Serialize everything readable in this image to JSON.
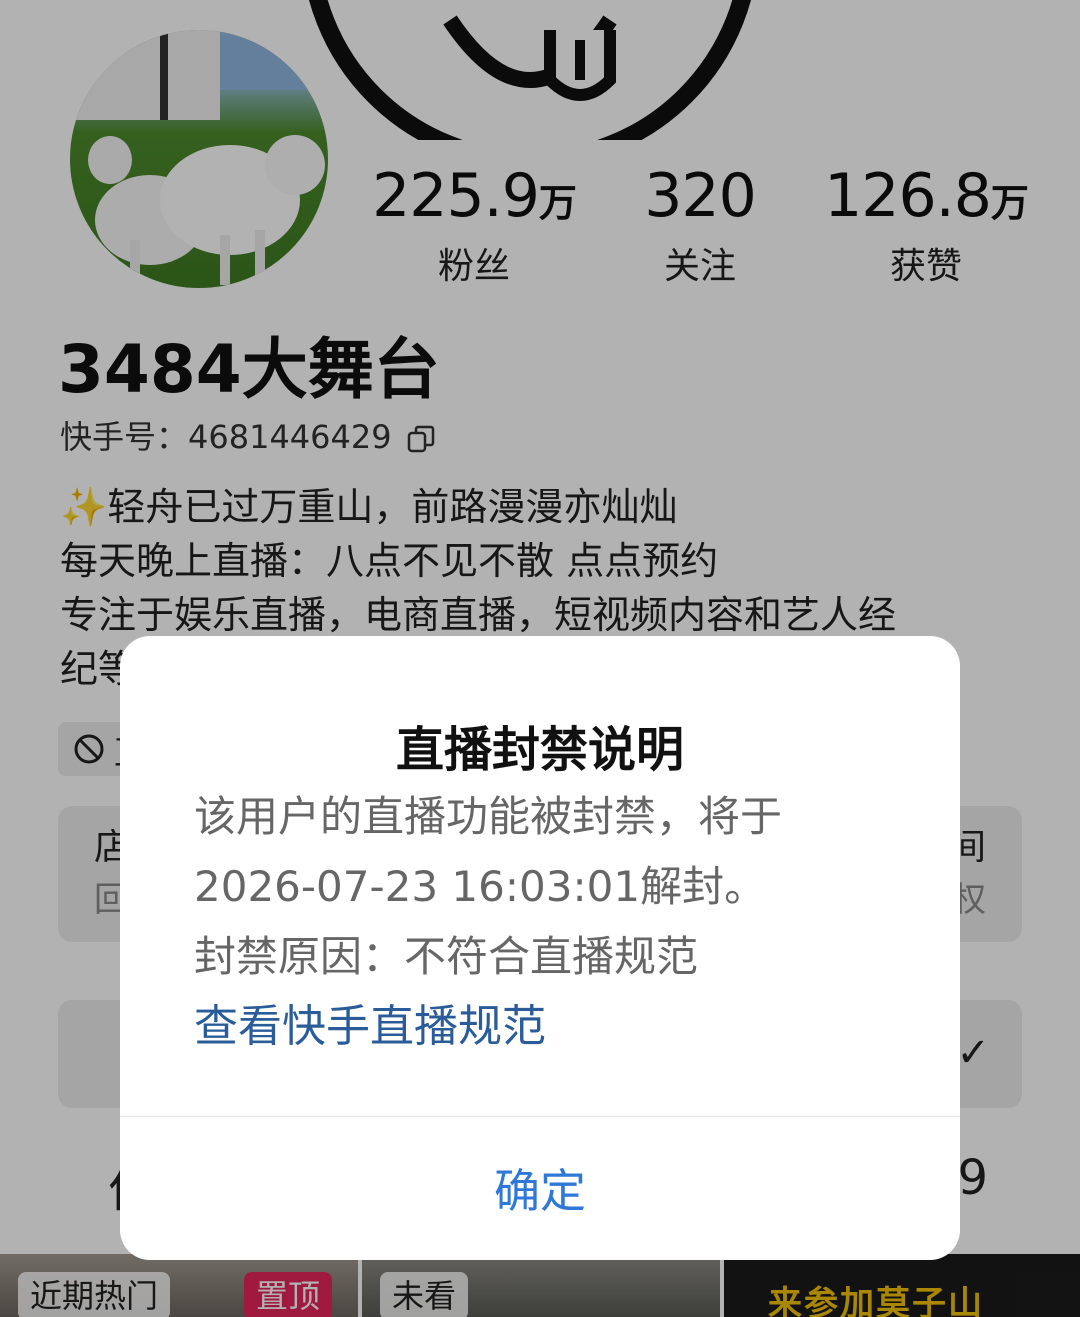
{
  "profile": {
    "stats": [
      {
        "num": "225.9",
        "unit": "万",
        "label": "粉丝"
      },
      {
        "num": "320",
        "unit": "",
        "label": "关注"
      },
      {
        "num": "126.8",
        "unit": "万",
        "label": "获赞"
      }
    ],
    "name": "3484大舞台",
    "kwai_id": "快手号：4681446429",
    "bio": [
      "✨轻舟已过万重山，前路漫漫亦灿灿",
      "每天晚上直播：八点不见不散 点点预约",
      "专注于娱乐直播，电商直播，短视频内容和艺人经",
      "纪等"
    ],
    "ban_chip": "直",
    "card_left": {
      "title": "店",
      "subtitle": "回"
    },
    "card_right": {
      "title": "间",
      "subtitle": "特权"
    },
    "tab_left": "作",
    "tab_right": "9",
    "thumbs": [
      {
        "chip": "近期热门",
        "badge": "置顶"
      },
      {
        "chip": "未看"
      },
      {
        "text": "来参加莫子山"
      }
    ]
  },
  "dialog": {
    "title": "直播封禁说明",
    "line1": "该用户的直播功能被封禁，将于",
    "line2": "2026-07-23 16:03:01解封。",
    "reason": "封禁原因：不符合直播规范",
    "link": "查看快手直播规范",
    "confirm": "确定"
  },
  "colors": {
    "link": "#2a5c9a",
    "confirm": "#2f78d8",
    "badge": "#e6245b"
  }
}
